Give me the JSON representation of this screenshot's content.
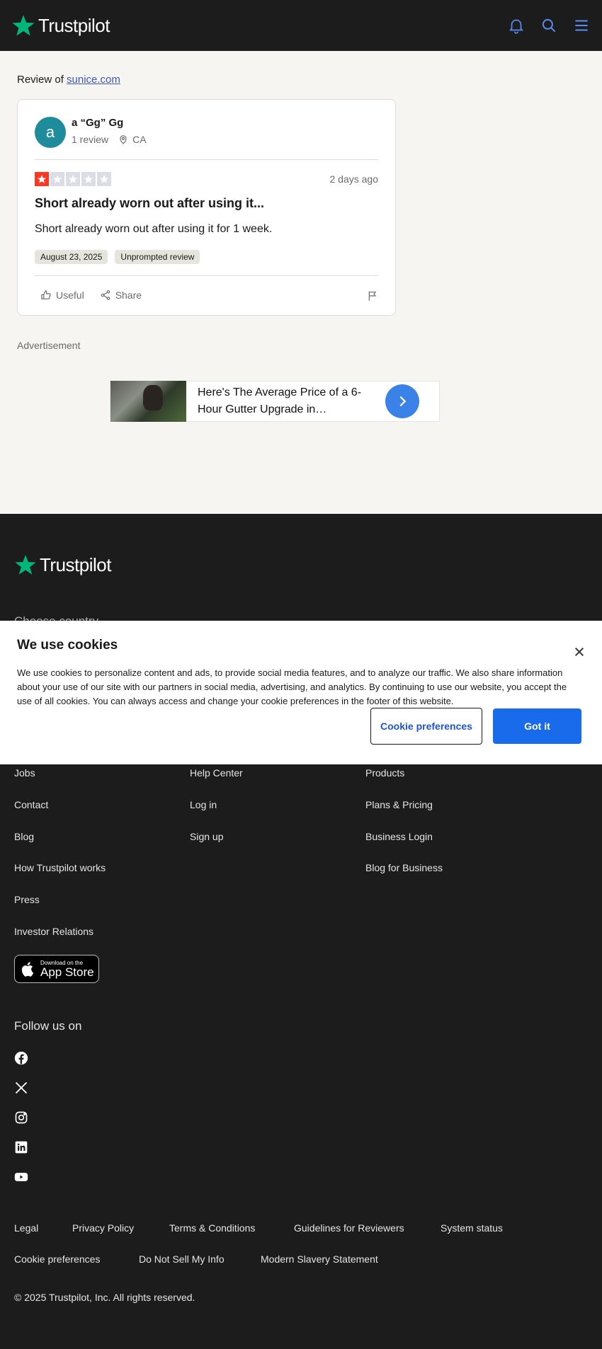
{
  "header": {
    "brand": "Trustpilot",
    "icons": [
      "bell-icon",
      "search-icon",
      "menu-icon"
    ],
    "accent_color": "#00b67a"
  },
  "review_page": {
    "review_of_label": "Review of",
    "company_link": "sunice.com"
  },
  "review": {
    "avatar_letter": "a",
    "reviewer_name": "a “Gg” Gg",
    "review_count": "1 review",
    "location": "CA",
    "rating": 1,
    "rating_max": 5,
    "star_color": "#ff3722",
    "date_ago": "2 days ago",
    "title": "Short already worn out after using it...",
    "body": "Short already worn out after using it for 1 week.",
    "tags": [
      "August 23, 2025",
      "Unprompted review"
    ],
    "useful_label": "Useful",
    "share_label": "Share"
  },
  "ad": {
    "label": "Advertisement",
    "text": "Here's The Average Price of a 6-Hour Gutter Upgrade in…"
  },
  "footer": {
    "brand": "Trustpilot",
    "choose_country": "Choose country",
    "col1": [
      "Jobs",
      "Contact",
      "Blog",
      "How Trustpilot works",
      "Press",
      "Investor Relations"
    ],
    "col2": [
      "Help Center",
      "Log in",
      "Sign up"
    ],
    "col3": [
      "Products",
      "Plans & Pricing",
      "Business Login",
      "Blog for Business"
    ],
    "appstore_small": "Download on the",
    "appstore_big": "App Store",
    "follow_label": "Follow us on",
    "social": [
      "facebook-icon",
      "x-icon",
      "instagram-icon",
      "linkedin-icon",
      "youtube-icon"
    ],
    "legal_row1": [
      "Legal",
      "Privacy Policy",
      "Terms & Conditions",
      "Guidelines for Reviewers",
      "System status"
    ],
    "legal_row2": [
      "Cookie preferences",
      "Do Not Sell My Info",
      "Modern Slavery Statement"
    ],
    "copyright": "© 2025 Trustpilot, Inc. All rights reserved."
  },
  "cookie_banner": {
    "title": "We use cookies",
    "text": "We use cookies to personalize content and ads, to provide social media features, and to analyze our traffic. We also share information about your use of our site with our partners in social media, advertising, and analytics. By continuing to use our website, you accept the use of all cookies. You can always access and change your cookie preferences in the footer of this website.",
    "prefs_button": "Cookie preferences",
    "accept_button": "Got it"
  }
}
